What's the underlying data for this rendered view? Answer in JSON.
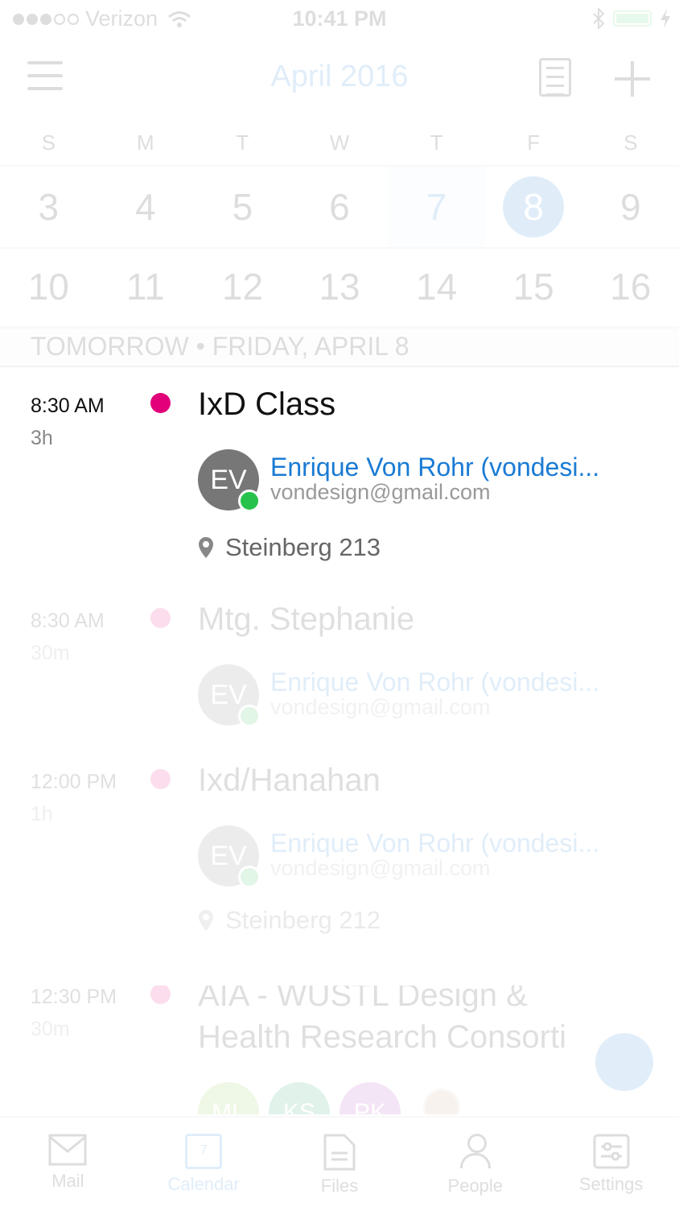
{
  "status_bar": {
    "carrier": "Verizon",
    "time": "10:41 PM"
  },
  "header": {
    "title": "April 2016"
  },
  "calendar": {
    "weekdays": [
      "S",
      "M",
      "T",
      "W",
      "T",
      "F",
      "S"
    ],
    "weeks": [
      [
        "3",
        "4",
        "5",
        "6",
        "7",
        "8",
        "9"
      ],
      [
        "10",
        "11",
        "12",
        "13",
        "14",
        "15",
        "16"
      ]
    ],
    "today": "7",
    "selected": "8"
  },
  "date_header": "TOMORROW • FRIDAY, APRIL 8",
  "events": [
    {
      "time": "8:30 AM",
      "duration": "3h",
      "title": "IxD Class",
      "attendee_initials": "EV",
      "attendee_name": "Enrique Von Rohr (vondesi...",
      "attendee_email": "vondesign@gmail.com",
      "location": "Steinberg 213",
      "dot_color": "#e2007a"
    },
    {
      "time": "8:30 AM",
      "duration": "30m",
      "title": "Mtg. Stephanie",
      "attendee_initials": "EV",
      "attendee_name": "Enrique Von Rohr (vondesi...",
      "attendee_email": "vondesign@gmail.com"
    },
    {
      "time": "12:00 PM",
      "duration": "1h",
      "title": "Ixd/Hanahan",
      "attendee_initials": "EV",
      "attendee_name": "Enrique Von Rohr (vondesi...",
      "attendee_email": "vondesign@gmail.com",
      "location": "Steinberg 212"
    },
    {
      "time": "12:30 PM",
      "duration": "30m",
      "title_line1": "AIA - WUSTL Design &",
      "title_line2": "Health Research Consorti",
      "attendees": [
        "ML",
        "KS",
        "PK"
      ]
    }
  ],
  "tabs": [
    {
      "label": "Mail",
      "icon": "mail-icon"
    },
    {
      "label": "Calendar",
      "icon": "calendar-icon",
      "badge": "7",
      "active": true
    },
    {
      "label": "Files",
      "icon": "files-icon"
    },
    {
      "label": "People",
      "icon": "people-icon"
    },
    {
      "label": "Settings",
      "icon": "settings-icon"
    }
  ],
  "colors": {
    "accent": "#1a7bd4",
    "event_dot": "#e2007a",
    "online": "#27c24c"
  }
}
